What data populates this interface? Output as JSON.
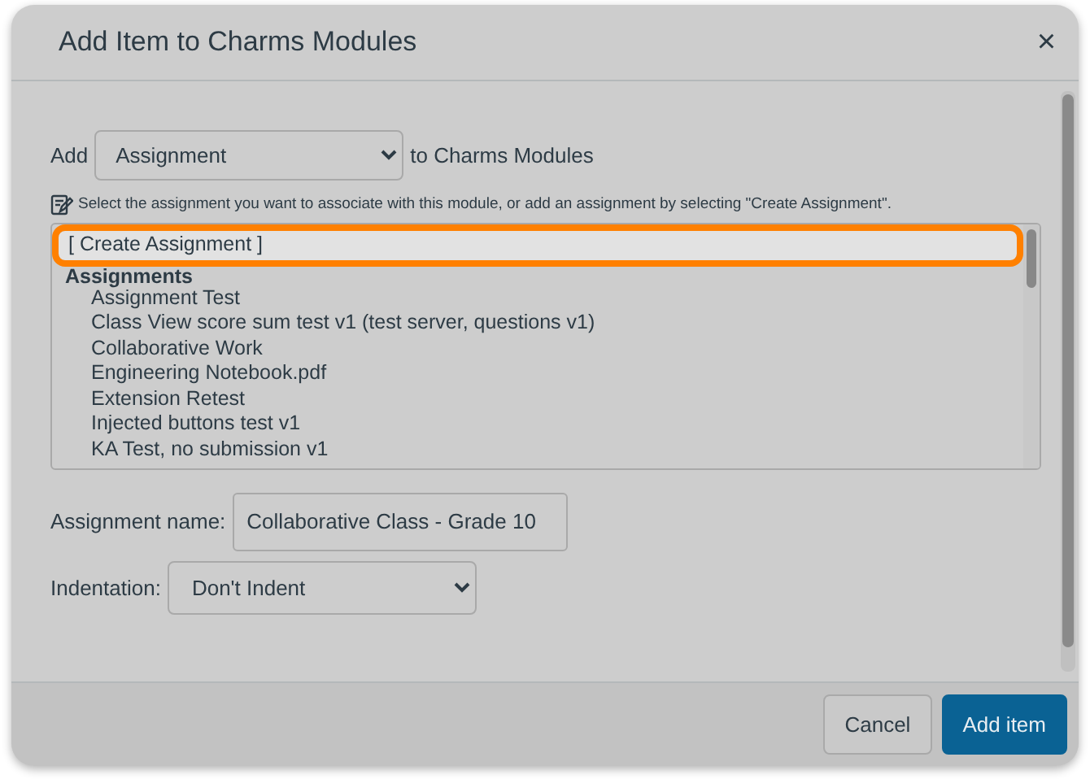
{
  "dialog": {
    "title": "Add Item to Charms Modules",
    "close": "×"
  },
  "add_row": {
    "prefix": "Add",
    "type_select": "Assignment",
    "suffix": "to Charms Modules"
  },
  "hint": "Select the assignment you want to associate with this module, or add an assignment by selecting \"Create Assignment\".",
  "listbox": [
    {
      "kind": "option",
      "label": "[ Create Assignment ]",
      "selected": true
    },
    {
      "kind": "group",
      "label": "Assignments"
    },
    {
      "kind": "option",
      "label": "Assignment Test",
      "selected": false
    },
    {
      "kind": "option",
      "label": "Class View score sum test v1 (test server, questions v1)",
      "selected": false
    },
    {
      "kind": "option",
      "label": "Collaborative Work",
      "selected": false
    },
    {
      "kind": "option",
      "label": "Engineering Notebook.pdf",
      "selected": false
    },
    {
      "kind": "option",
      "label": "Extension Retest",
      "selected": false
    },
    {
      "kind": "option",
      "label": "Injected buttons test v1",
      "selected": false
    },
    {
      "kind": "option",
      "label": "KA Test, no submission v1",
      "selected": false
    }
  ],
  "assignment_name": {
    "label": "Assignment name:",
    "value": "Collaborative Class - Grade 10"
  },
  "indentation": {
    "label": "Indentation:",
    "value": "Don't Indent"
  },
  "buttons": [
    {
      "kind": "secondary",
      "label": "Cancel"
    },
    {
      "kind": "primary",
      "label": "Add item"
    }
  ]
}
